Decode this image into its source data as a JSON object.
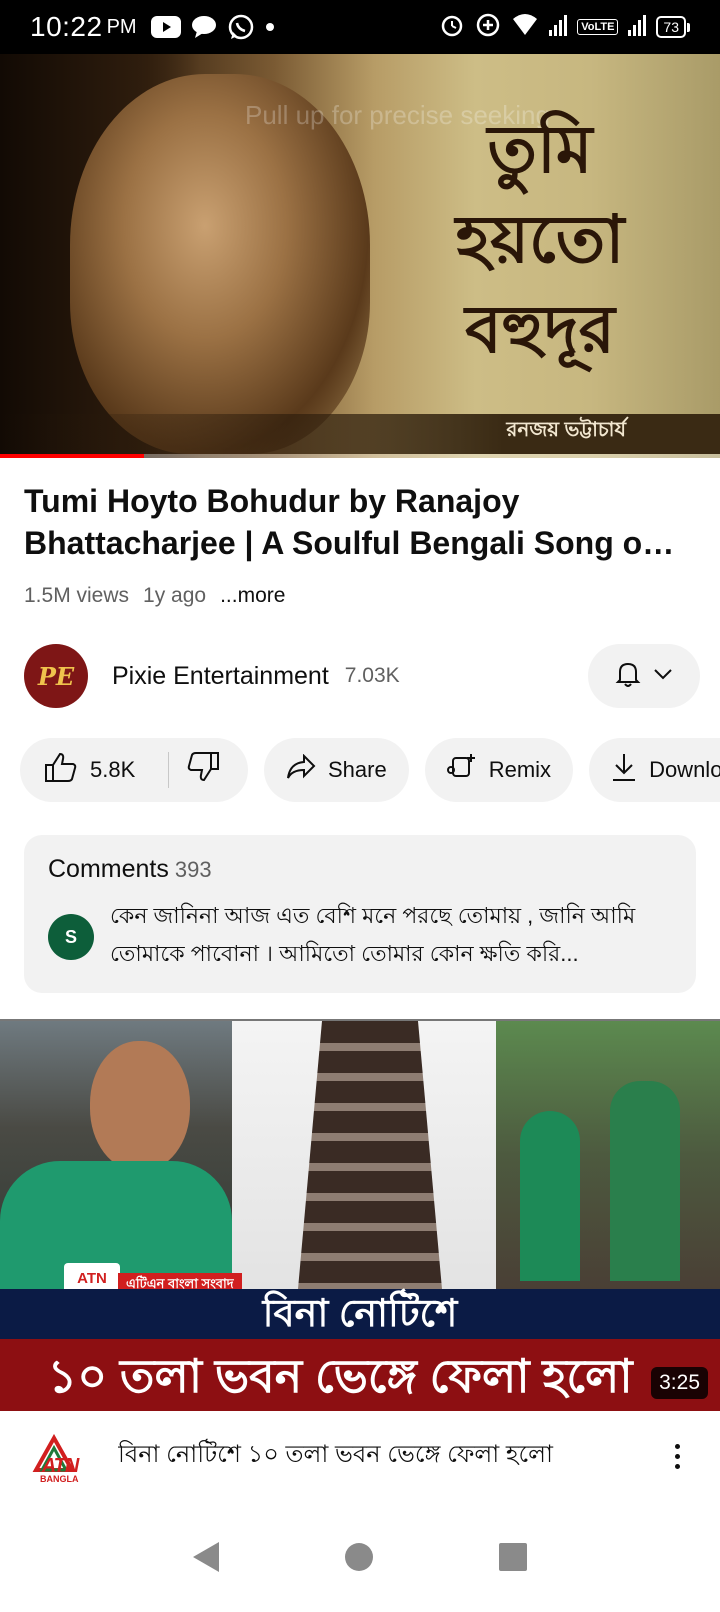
{
  "status_bar": {
    "time": "10:22",
    "ampm": "PM",
    "network": "VoLTE",
    "battery": "73",
    "icons": [
      "youtube-icon",
      "messages-icon",
      "whatsapp-icon",
      "dot-icon",
      "alarm-icon",
      "data-saver-icon",
      "wifi-icon",
      "signal-icon",
      "signal-icon-2"
    ]
  },
  "player": {
    "hint": "Pull up for precise seeking",
    "lyrics": [
      "তুমি",
      "হয়তো",
      "বহুদূর"
    ],
    "credit": "রনজয় ভট্টাচার্য",
    "progress": 0.2
  },
  "video": {
    "title": "Tumi Hoyto Bohudur by Ranajoy Bhattacharjee | A Soulful Bengali Song o…",
    "views": "1.5M views",
    "age": "1y ago",
    "more": "...more"
  },
  "channel": {
    "avatar_text": "PE",
    "name": "Pixie Entertainment",
    "subscribers": "7.03K"
  },
  "actions": {
    "likes": "5.8K",
    "share": "Share",
    "remix": "Remix",
    "download": "Download"
  },
  "comments": {
    "label": "Comments",
    "count": "393",
    "first_author_initial": "S",
    "first_text": "কেন জানিনা আজ এত বেশি মনে পরছে তোমায় , জানি আমি তোমাকে পাবোনা । আমিতো তোমার কোন ক্ষতি করি..."
  },
  "next_video": {
    "thumb_tag": "এটিএন বাংলা সংবাদ",
    "thumb_logo": "ATN",
    "headline_top": "বিনা নোটিশে",
    "headline_bottom": "১০ তলা ভবন ভেঙ্গে ফেলা হলো",
    "duration": "3:25",
    "channel_logo": "ATN",
    "channel_logo_sub": "BANGLA",
    "title": "বিনা নোটিশে ১০ তলা ভবন ভেঙ্গে ফেলা হলো"
  },
  "colors": {
    "accent": "#ff0000",
    "pill_bg": "#f2f2f2",
    "secondary_text": "#606060",
    "channel_avatar": "#7e1616",
    "comment_avatar": "#0d5e3a"
  }
}
